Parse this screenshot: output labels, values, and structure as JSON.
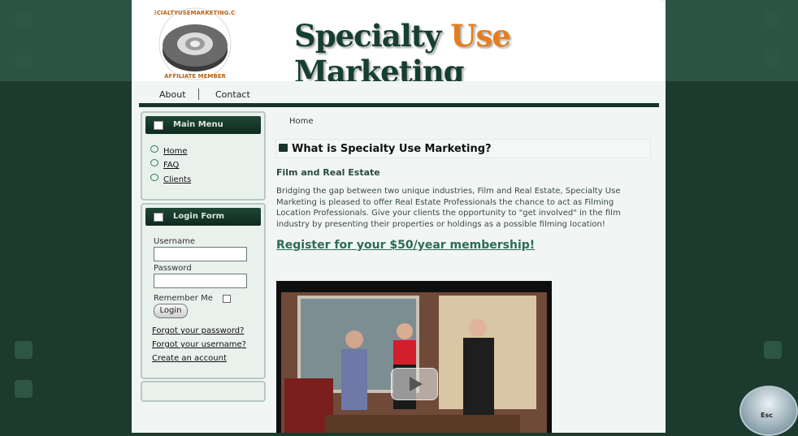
{
  "site": {
    "brand_part1": "Specialty ",
    "brand_accent": "Use",
    "brand_part2": " Marketing",
    "logo_text_top": "SPECIALTYUSEMARKETING.COM",
    "logo_text_bottom": "AFFILIATE MEMBER",
    "accent_color": "#e47d1f",
    "dark_green": "#163427"
  },
  "top_nav": {
    "items": [
      {
        "label": "About"
      },
      {
        "label": "Contact"
      }
    ]
  },
  "main_menu": {
    "title": "Main Menu",
    "items": [
      {
        "label": "Home"
      },
      {
        "label": "FAQ"
      },
      {
        "label": "Clients"
      }
    ]
  },
  "login_form": {
    "title": "Login Form",
    "username_label": "Username",
    "password_label": "Password",
    "remember_label": "Remember Me",
    "login_button": "Login",
    "forgot_password": "Forgot your password?",
    "forgot_username": "Forgot your username?",
    "create_account": "Create an account"
  },
  "content": {
    "breadcrumb": "Home",
    "title": "What is Specialty Use Marketing?",
    "subtitle": "Film and Real Estate",
    "body": "Bridging the gap between two unique industries, Film and Real Estate, Specialty Use Marketing is pleased to offer Real Estate Professionals the chance to act as Filming Location Professionals. Give your clients the opportunity to \"get involved\" in the film industry by presenting their properties or holdings as a possible filming location!",
    "register_link": "Register for your $50/year membership!"
  },
  "overlay": {
    "esc_label": "Esc"
  }
}
